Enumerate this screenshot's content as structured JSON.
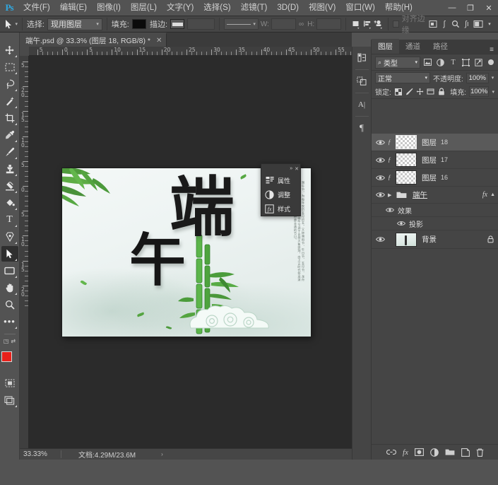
{
  "app": {
    "name": "Ps",
    "logo_color": "#31a8e0"
  },
  "menubar": {
    "items": [
      {
        "label": "文件(F)"
      },
      {
        "label": "编辑(E)"
      },
      {
        "label": "图像(I)"
      },
      {
        "label": "图层(L)"
      },
      {
        "label": "文字(Y)"
      },
      {
        "label": "选择(S)"
      },
      {
        "label": "滤镜(T)"
      },
      {
        "label": "3D(D)"
      },
      {
        "label": "视图(V)"
      },
      {
        "label": "窗口(W)"
      },
      {
        "label": "帮助(H)"
      }
    ],
    "window_buttons": {
      "minimize": "—",
      "maximize": "❐",
      "close": "✕"
    }
  },
  "options_bar": {
    "tool_icon": "move-tool-icon",
    "select_label": "选择:",
    "select_value": "现用图层",
    "fill_label": "填充:",
    "fill_color": "#0b0b0b",
    "stroke_label": "描边:",
    "stroke_color": "#dcdcdc",
    "stroke_width_value": "",
    "dash_value": "",
    "w_label": "W:",
    "w_value": "",
    "link_icon": "link-icon",
    "h_label": "H:",
    "h_value": "",
    "align_buttons": [
      "align-left-icon",
      "distribute-icon",
      "align-more-icon"
    ],
    "snap_label": "对齐边缘",
    "snap_checked": false,
    "right_icons": [
      "3d-icon",
      "hand-icon",
      "zoom-icon",
      "settings-icon",
      "workspace-icon"
    ]
  },
  "tabbar": {
    "tab_title": "端午.psd @ 33.3% (图层 18, RGB/8) *",
    "close_glyph": "✕"
  },
  "toolbar": {
    "tools": [
      {
        "name": "move-tool",
        "glyph": "✥",
        "active": false,
        "has_corner": true
      },
      {
        "name": "marquee-tool",
        "glyph": "marquee",
        "active": false,
        "has_corner": true
      },
      {
        "name": "lasso-tool",
        "glyph": "lasso",
        "active": false,
        "has_corner": true
      },
      {
        "name": "magic-wand-tool",
        "glyph": "wand",
        "active": false,
        "has_corner": true
      },
      {
        "name": "crop-tool",
        "glyph": "crop",
        "active": false,
        "has_corner": true
      },
      {
        "name": "eyedropper-tool",
        "glyph": "eyedropper",
        "active": false,
        "has_corner": true
      },
      {
        "name": "healing-brush-tool",
        "glyph": "healing",
        "active": false,
        "has_corner": true
      },
      {
        "name": "brush-tool",
        "glyph": "brush",
        "active": false,
        "has_corner": true
      },
      {
        "name": "clone-stamp-tool",
        "glyph": "stamp",
        "active": false,
        "has_corner": true
      },
      {
        "name": "eraser-tool",
        "glyph": "eraser",
        "active": false,
        "has_corner": true
      },
      {
        "name": "gradient-tool",
        "glyph": "bucket",
        "active": false,
        "has_corner": true
      },
      {
        "name": "type-tool",
        "glyph": "T",
        "active": false,
        "has_corner": true
      },
      {
        "name": "pen-tool",
        "glyph": "pen",
        "active": false,
        "has_corner": true
      },
      {
        "name": "path-selection-tool",
        "glyph": "arrow",
        "active": true,
        "has_corner": true
      },
      {
        "name": "rectangle-tool",
        "glyph": "rect",
        "active": false,
        "has_corner": true
      },
      {
        "name": "hand-tool",
        "glyph": "hand",
        "active": false,
        "has_corner": true
      },
      {
        "name": "zoom-tool",
        "glyph": "zoom",
        "active": false,
        "has_corner": false
      },
      {
        "name": "more-tools",
        "glyph": "…",
        "active": false,
        "has_corner": true
      }
    ],
    "foreground_color": "#e8201a",
    "background_color": "#ffffff",
    "quick_mask_name": "quick-mask-icon",
    "screen_mode_name": "screen-mode-icon"
  },
  "rulers": {
    "horizontal_ticks": [
      "5",
      "0",
      "5",
      "10",
      "15",
      "20",
      "25",
      "30",
      "35",
      "40",
      "45",
      "50",
      "55"
    ],
    "vertical_ticks": [
      "5",
      "20",
      "15",
      "10",
      "5",
      "0",
      "5",
      "10",
      "15",
      "20"
    ]
  },
  "canvas": {
    "artwork_title": "端午",
    "main_char_1": "端",
    "main_char_2": "午",
    "side_poem": "端午节，为每年农历五月初五，又称端阳节、午日节、五月节、龙舟节、浴兰节、天中节等。端午节源于自然天象崇拜，由上古时代祭龙演变而来，是中国首个入选世界非遗的节日。"
  },
  "context_menu": {
    "collapse_glyph": "»",
    "close_glyph": "✕",
    "items": [
      {
        "label": "属性",
        "icon": "properties-icon"
      },
      {
        "label": "调整",
        "icon": "adjustments-icon"
      },
      {
        "label": "样式",
        "icon": "styles-icon"
      }
    ]
  },
  "statusbar": {
    "zoom": "33.33%",
    "doc_info": "文档:4.29M/23.6M",
    "arrow_glyph": "›"
  },
  "icon_dock": {
    "icons": [
      {
        "name": "color-panel-icon",
        "glyph": "color"
      },
      {
        "name": "swatches-panel-icon",
        "glyph": "swatch"
      },
      {
        "name": "character-panel-icon",
        "glyph": "A|"
      },
      {
        "name": "paragraph-panel-icon",
        "glyph": "¶"
      }
    ]
  },
  "layers_panel": {
    "tabs": [
      {
        "label": "图层",
        "active": true
      },
      {
        "label": "通道",
        "active": false
      },
      {
        "label": "路径",
        "active": false
      }
    ],
    "menu_glyph": "≡",
    "filter": {
      "search_icon": "search-icon",
      "kind_label": "类型",
      "icons": [
        "pixel-filter-icon",
        "adjustment-filter-icon",
        "type-filter-icon",
        "shape-filter-icon",
        "smartobject-filter-icon"
      ],
      "toggle_name": "filter-toggle"
    },
    "blend_mode": "正常",
    "opacity_label": "不透明度:",
    "opacity_value": "100%",
    "lock_label": "锁定:",
    "lock_icons": [
      "lock-transparent-icon",
      "lock-image-icon",
      "lock-position-icon",
      "lock-artboard-icon",
      "lock-all-icon"
    ],
    "fill_label": "填充:",
    "fill_value": "100%",
    "layers": [
      {
        "name": "图层",
        "number": "18",
        "type": "raster",
        "selected": true,
        "visible": true,
        "has_fx_mark": true
      },
      {
        "name": "图层",
        "number": "17",
        "type": "raster",
        "selected": false,
        "visible": true,
        "has_fx_mark": true
      },
      {
        "name": "图层",
        "number": "16",
        "type": "raster",
        "selected": false,
        "visible": true,
        "has_fx_mark": true
      },
      {
        "name": "端午",
        "number": "",
        "type": "group",
        "selected": false,
        "visible": true,
        "fx_letter": "fx",
        "children": [
          {
            "name": "效果",
            "depth": 1,
            "visible": true
          },
          {
            "name": "投影",
            "depth": 2,
            "visible": true
          }
        ]
      },
      {
        "name": "背景",
        "number": "",
        "type": "background",
        "selected": false,
        "visible": true,
        "locked": true,
        "lock_glyph": "🔒"
      }
    ],
    "footer_icons": [
      {
        "name": "link-layers-icon",
        "glyph": "⛓"
      },
      {
        "name": "layer-style-icon",
        "glyph": "fx"
      },
      {
        "name": "layer-mask-icon",
        "glyph": "mask"
      },
      {
        "name": "adjustment-layer-icon",
        "glyph": "half"
      },
      {
        "name": "new-group-icon",
        "glyph": "folder"
      },
      {
        "name": "new-layer-icon",
        "glyph": "page"
      },
      {
        "name": "delete-layer-icon",
        "glyph": "trash"
      }
    ]
  }
}
